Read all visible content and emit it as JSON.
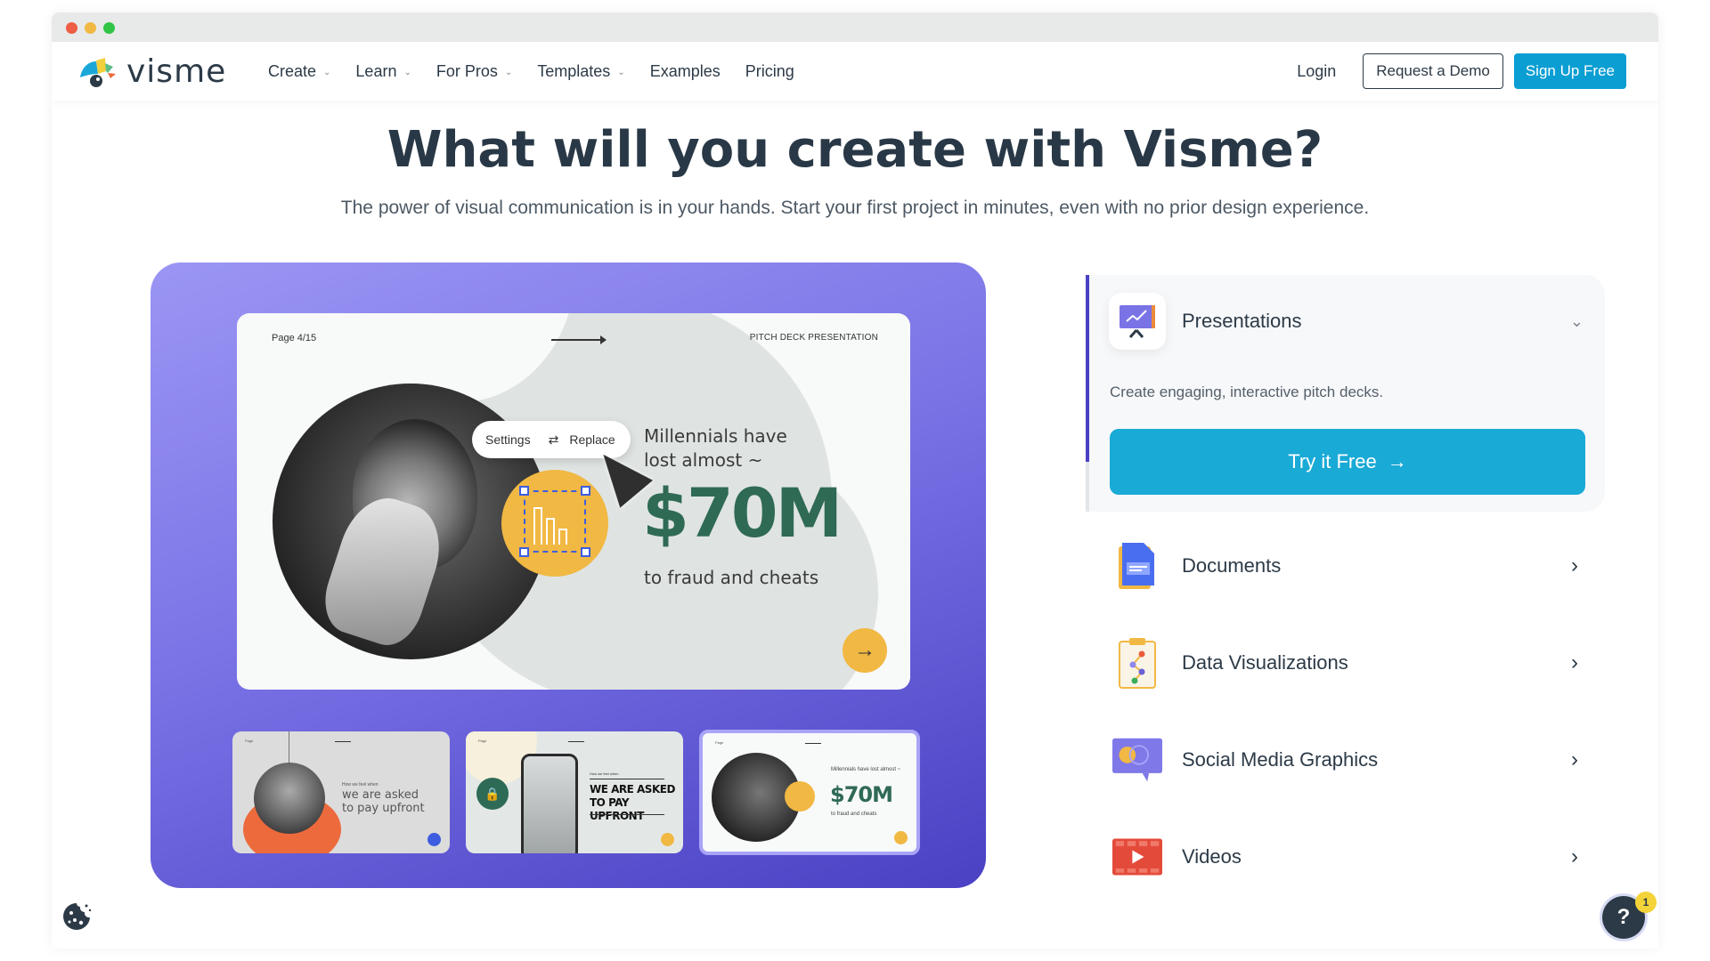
{
  "window": {
    "controls": [
      "close",
      "minimize",
      "maximize"
    ]
  },
  "navbar": {
    "logo_text": "visme",
    "items": [
      {
        "label": "Create",
        "has_dropdown": true
      },
      {
        "label": "Learn",
        "has_dropdown": true
      },
      {
        "label": "For Pros",
        "has_dropdown": true
      },
      {
        "label": "Templates",
        "has_dropdown": true
      },
      {
        "label": "Examples",
        "has_dropdown": false
      },
      {
        "label": "Pricing",
        "has_dropdown": false
      }
    ],
    "login_label": "Login",
    "demo_label": "Request a Demo",
    "signup_label": "Sign Up Free",
    "dropdown_glyph": "⌄"
  },
  "hero": {
    "title": "What will you create with Visme?",
    "subtitle": "The power of visual communication is in your hands. Start your first project in minutes, even with no prior design experience."
  },
  "preview": {
    "main_slide": {
      "page": "Page 4/15",
      "label": "PITCH DECK PRESENTATION",
      "toolbar_settings": "Settings",
      "toolbar_replace": "Replace",
      "line1": "Millennials have",
      "line2": "lost almost ~",
      "big_value": "$70M",
      "line3": "to fraud and cheats",
      "next_glyph": "→"
    },
    "thumbnails": [
      {
        "small": "How we feel when",
        "line1": "we are asked",
        "line2": "to pay upfront",
        "button_color": "#3e5de0"
      },
      {
        "small": "How we feel when",
        "line1": "WE ARE ASKED",
        "line2": "TO PAY UPFRONT",
        "button_color": "#f1b843",
        "selected": false
      },
      {
        "small": "Millennials have lost almost ~",
        "big": "$70M",
        "line3": "to fraud and cheats",
        "button_color": "#f1b843",
        "selected": true
      }
    ]
  },
  "categories": {
    "active": {
      "title": "Presentations",
      "description": "Create engaging, interactive pitch decks.",
      "cta_label": "Try it Free",
      "cta_arrow": "→",
      "expanded_glyph": "⌄",
      "progress": 0.79
    },
    "items": [
      {
        "title": "Documents",
        "icon": "document-icon"
      },
      {
        "title": "Data Visualizations",
        "icon": "data-visualization-icon"
      },
      {
        "title": "Social Media Graphics",
        "icon": "social-media-icon"
      },
      {
        "title": "Videos",
        "icon": "video-icon"
      }
    ],
    "chevron_glyph": "›"
  },
  "widgets": {
    "help_label": "?",
    "help_badge": "1"
  },
  "colors": {
    "brand_blue": "#0b9ed3",
    "cta_blue": "#1aaad6",
    "accent_purple": "#4a40c3",
    "text_dark": "#2c3a47",
    "highlight_green": "#2f6a55",
    "highlight_yellow": "#f1b843"
  }
}
